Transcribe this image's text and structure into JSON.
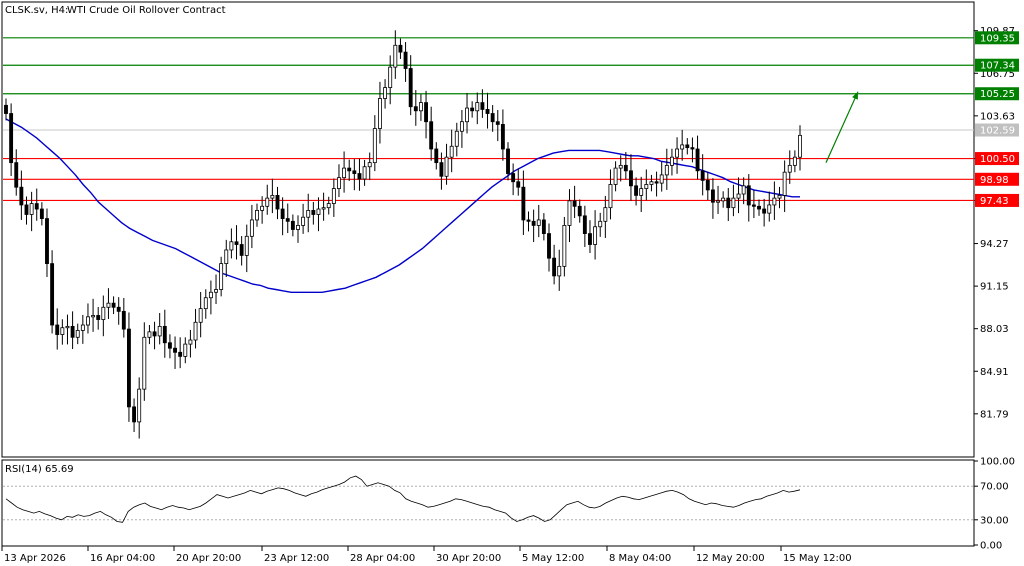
{
  "header": {
    "symbol": "CLSK.sv, H4:",
    "instrument": "WTI Crude Oil Rollover Contract"
  },
  "rsi_label": "RSI(14) 65.69",
  "colors": {
    "support_lines": "#ff0000",
    "resistance_lines": "#008000",
    "moving_average": "#0000cc",
    "candles": "#000000",
    "rsi_line": "#000000",
    "arrow": "#008000",
    "current_price_label": "#c0c0c0"
  },
  "chart_data": [
    {
      "type": "candlestick",
      "y_ticks": [
        "109.87",
        "106.75",
        "103.63",
        "100.50",
        "97.43",
        "94.27",
        "91.15",
        "88.03",
        "84.91",
        "81.79"
      ],
      "ylim": [
        78.7,
        111.9
      ],
      "x_ticks": [
        "13 Apr 2026",
        "16 Apr 04:00",
        "20 Apr 20:00",
        "23 Apr 12:00",
        "28 Apr 04:00",
        "30 Apr 20:00",
        "5 May 12:00",
        "8 May 04:00",
        "12 May 20:00",
        "15 May 12:00"
      ],
      "current_price": "102.59",
      "resistance_levels": [
        {
          "value": 109.35,
          "label": "109.35"
        },
        {
          "value": 107.34,
          "label": "107.34"
        },
        {
          "value": 105.25,
          "label": "105.25"
        }
      ],
      "support_levels": [
        {
          "value": 100.5,
          "label": "100.50"
        },
        {
          "value": 98.98,
          "label": "98.98"
        },
        {
          "value": 97.43,
          "label": "97.43"
        }
      ],
      "ohlc_close": [
        103.8,
        100.2,
        98.4,
        97.1,
        96.4,
        97.2,
        96.8,
        96.1,
        92.8,
        88.3,
        87.6,
        88.1,
        88.2,
        87.4,
        87.9,
        88.3,
        88.9,
        89.0,
        88.7,
        89.6,
        89.9,
        89.6,
        89.3,
        88.0,
        82.3,
        81.2,
        83.6,
        87.4,
        87.8,
        87.5,
        88.2,
        87.0,
        86.6,
        86.3,
        86.0,
        86.9,
        87.2,
        88.5,
        89.5,
        90.3,
        90.7,
        90.9,
        92.8,
        93.8,
        94.4,
        94.2,
        93.4,
        94.8,
        96.0,
        96.7,
        97.0,
        97.6,
        97.8,
        96.8,
        96.1,
        95.9,
        95.3,
        95.6,
        96.2,
        96.7,
        96.4,
        96.8,
        96.9,
        97.2,
        98.3,
        99.1,
        99.8,
        99.6,
        99.4,
        99.0,
        99.9,
        100.2,
        102.7,
        104.9,
        105.7,
        107.2,
        108.8,
        108.3,
        107.1,
        104.3,
        104.0,
        104.6,
        103.2,
        101.2,
        100.2,
        99.2,
        100.6,
        101.4,
        102.5,
        103.2,
        104.2,
        104.0,
        104.6,
        104.1,
        103.8,
        103.2,
        103.0,
        101.2,
        99.4,
        98.8,
        98.4,
        96.0,
        95.9,
        95.6,
        96.0,
        95.0,
        93.2,
        91.9,
        92.6,
        95.6,
        97.4,
        97.0,
        96.3,
        95.0,
        94.2,
        95.5,
        95.9,
        96.9,
        98.6,
        99.8,
        100.0,
        99.6,
        98.5,
        97.8,
        98.3,
        98.6,
        98.8,
        98.7,
        99.3,
        100.0,
        100.6,
        101.2,
        101.5,
        101.3,
        101.2,
        99.6,
        98.9,
        98.2,
        97.3,
        97.4,
        97.6,
        96.9,
        97.6,
        97.9,
        98.5,
        97.1,
        97.0,
        96.8,
        96.5,
        97.1,
        97.6,
        97.8,
        99.5,
        100.0,
        100.6,
        102.2
      ],
      "series": [
        {
          "name": "MA",
          "values": [
            103.4,
            103.1,
            102.8,
            102.4,
            102.0,
            101.5,
            101.0,
            100.5,
            99.9,
            99.3,
            98.6,
            98.0,
            97.3,
            96.8,
            96.3,
            95.8,
            95.4,
            95.1,
            94.8,
            94.5,
            94.3,
            94.1,
            93.9,
            93.6,
            93.3,
            93.0,
            92.7,
            92.4,
            92.1,
            91.9,
            91.7,
            91.5,
            91.3,
            91.2,
            91.0,
            90.9,
            90.8,
            90.7,
            90.7,
            90.7,
            90.7,
            90.7,
            90.8,
            90.9,
            91.0,
            91.2,
            91.4,
            91.6,
            91.8,
            92.1,
            92.4,
            92.7,
            93.1,
            93.5,
            93.9,
            94.4,
            94.9,
            95.4,
            95.9,
            96.4,
            96.9,
            97.4,
            97.9,
            98.4,
            98.8,
            99.2,
            99.6,
            99.9,
            100.2,
            100.5,
            100.7,
            100.9,
            101.0,
            101.1,
            101.1,
            101.1,
            101.1,
            101.1,
            101.0,
            100.9,
            100.8,
            100.7,
            100.7,
            100.6,
            100.5,
            100.3,
            100.2,
            100.1,
            100.0,
            99.9,
            99.7,
            99.5,
            99.3,
            99.1,
            98.8,
            98.6,
            98.4,
            98.2,
            98.1,
            98.0,
            97.9,
            97.8,
            97.7,
            97.7
          ]
        }
      ]
    },
    {
      "type": "line",
      "title": "RSI(14) 65.69",
      "y_ticks": [
        "100.00",
        "70.00",
        "30.00",
        "0.00"
      ],
      "ylim": [
        0,
        100
      ],
      "levels": [
        70,
        30
      ],
      "series": [
        {
          "name": "RSI(14)",
          "values": [
            55,
            50,
            45,
            42,
            40,
            38,
            40,
            37,
            35,
            32,
            30,
            34,
            33,
            36,
            34,
            35,
            38,
            40,
            36,
            33,
            28,
            27,
            40,
            45,
            48,
            50,
            46,
            44,
            42,
            45,
            47,
            45,
            44,
            42,
            44,
            46,
            50,
            55,
            60,
            58,
            56,
            58,
            60,
            62,
            65,
            63,
            61,
            64,
            66,
            68,
            67,
            65,
            62,
            60,
            58,
            61,
            63,
            66,
            68,
            70,
            72,
            75,
            80,
            82,
            78,
            70,
            72,
            74,
            72,
            70,
            65,
            62,
            55,
            52,
            50,
            48,
            45,
            46,
            48,
            50,
            52,
            55,
            54,
            52,
            50,
            48,
            46,
            45,
            42,
            40,
            38,
            32,
            28,
            30,
            33,
            35,
            32,
            28,
            30,
            36,
            42,
            48,
            50,
            52,
            48,
            45,
            44,
            46,
            50,
            53,
            56,
            58,
            57,
            55,
            54,
            56,
            58,
            60,
            62,
            64,
            65,
            63,
            60,
            55,
            52,
            50,
            48,
            50,
            49,
            47,
            46,
            45,
            47,
            50,
            52,
            54,
            55,
            58,
            60,
            62,
            65,
            63,
            64,
            65.69
          ]
        }
      ]
    }
  ]
}
